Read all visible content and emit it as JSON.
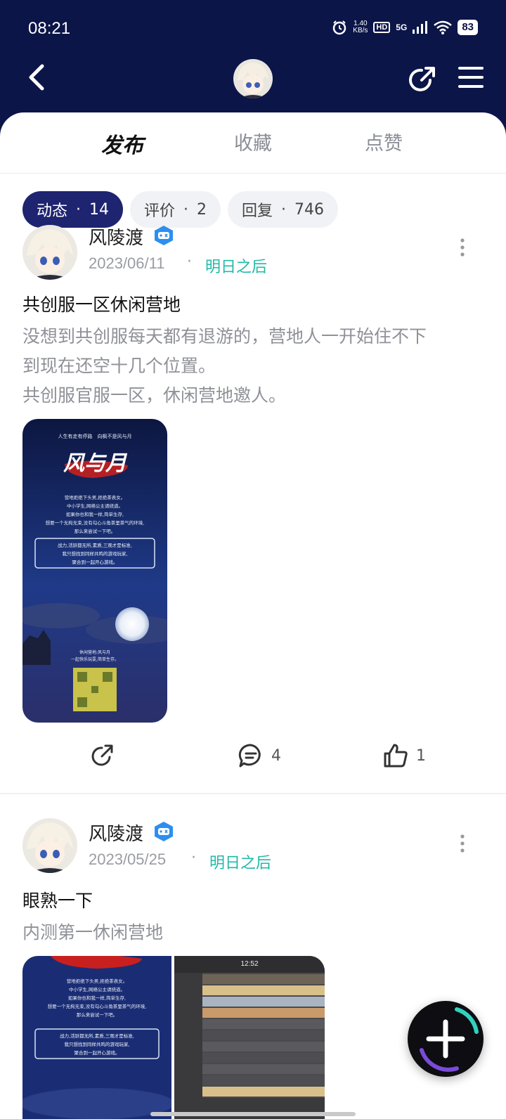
{
  "status_bar": {
    "time": "08:21",
    "net_speed_value": "1.40",
    "net_speed_unit": "KB/s",
    "hd": "HD",
    "signal": "5G",
    "battery": "83"
  },
  "header": {
    "back_icon": "back-arrow-icon",
    "share_icon": "share-icon",
    "menu_icon": "menu-icon"
  },
  "tabs": [
    {
      "label": "发布",
      "active": true
    },
    {
      "label": "收藏",
      "active": false
    },
    {
      "label": "点赞",
      "active": false
    }
  ],
  "filters": [
    {
      "label": "动态",
      "sep": "·",
      "count": "14",
      "active": true
    },
    {
      "label": "评价",
      "sep": "·",
      "count": "2",
      "active": false
    },
    {
      "label": "回复",
      "sep": "·",
      "count": "746",
      "active": false
    }
  ],
  "posts": [
    {
      "author": "风陵渡",
      "date": "2023/06/11",
      "sep": "·",
      "game": "明日之后",
      "title": "共创服一区休闲营地",
      "body_lines": [
        "没想到共创服每天都有退游的，营地人一开始住不下",
        "到现在还空十几个位置。",
        "共创服官服一区，休闲营地邀人。"
      ],
      "comment_count": "4",
      "like_count": "1"
    },
    {
      "author": "风陵渡",
      "date": "2023/05/25",
      "sep": "·",
      "game": "明日之后",
      "title": "眼熟一下",
      "body_lines": [
        "内测第一休闲营地"
      ],
      "screenshot_time": "12:52"
    }
  ],
  "poster": {
    "top_line": "人生有走有停路　向枫不是风与月",
    "title": "风与月",
    "lines": [
      "营地拒绝下头男,拒绝茶表女。",
      "中小学生,网络公主请绕道。",
      "如果你也和我一样,简单生存,",
      "想要一个无拘无束,没有勾心斗角茶里茶气的环境,",
      "那么来尝试一下吧。"
    ],
    "box_lines": [
      "战力,活跃都无所,素质,三观才是标准,",
      "我只想找到同样共鸣的游戏玩家,",
      "聚合到一起开心游戏。"
    ],
    "footer_lines": [
      "休闲营地:风与月",
      "一起快乐玩耍,简单生存。"
    ]
  },
  "colors": {
    "header_bg": "#0c1548",
    "accent": "#21b9a8",
    "chip_active": "#1e2470"
  },
  "fab_icon": "plus-icon"
}
